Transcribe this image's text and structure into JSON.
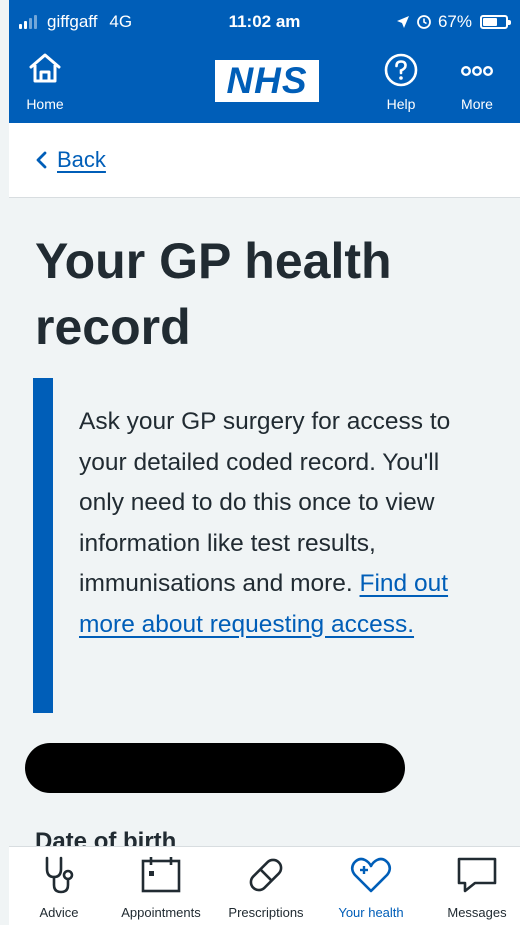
{
  "status_bar": {
    "carrier": "giffgaff",
    "network": "4G",
    "time": "11:02 am",
    "battery": "67%",
    "battery_level": 0.67
  },
  "header": {
    "home_label": "Home",
    "logo_text": "NHS",
    "help_label": "Help",
    "more_label": "More",
    "background_color": "#005eb8"
  },
  "back_label": "Back",
  "page_title": "Your GP health record",
  "inset": {
    "text": "Ask your GP surgery for access to your detailed coded record. You'll only need to do this once to view information like test results, immunisations and more.",
    "link": "Find out more about requesting access."
  },
  "partial_heading": "Date of birth",
  "tabs": [
    {
      "label": "Advice",
      "icon": "stethoscope-icon"
    },
    {
      "label": "Appointments",
      "icon": "calendar-icon"
    },
    {
      "label": "Prescriptions",
      "icon": "pill-icon"
    },
    {
      "label": "Your health",
      "icon": "heart-plus-icon",
      "active": true
    },
    {
      "label": "Messages",
      "icon": "speech-bubble-icon"
    }
  ]
}
